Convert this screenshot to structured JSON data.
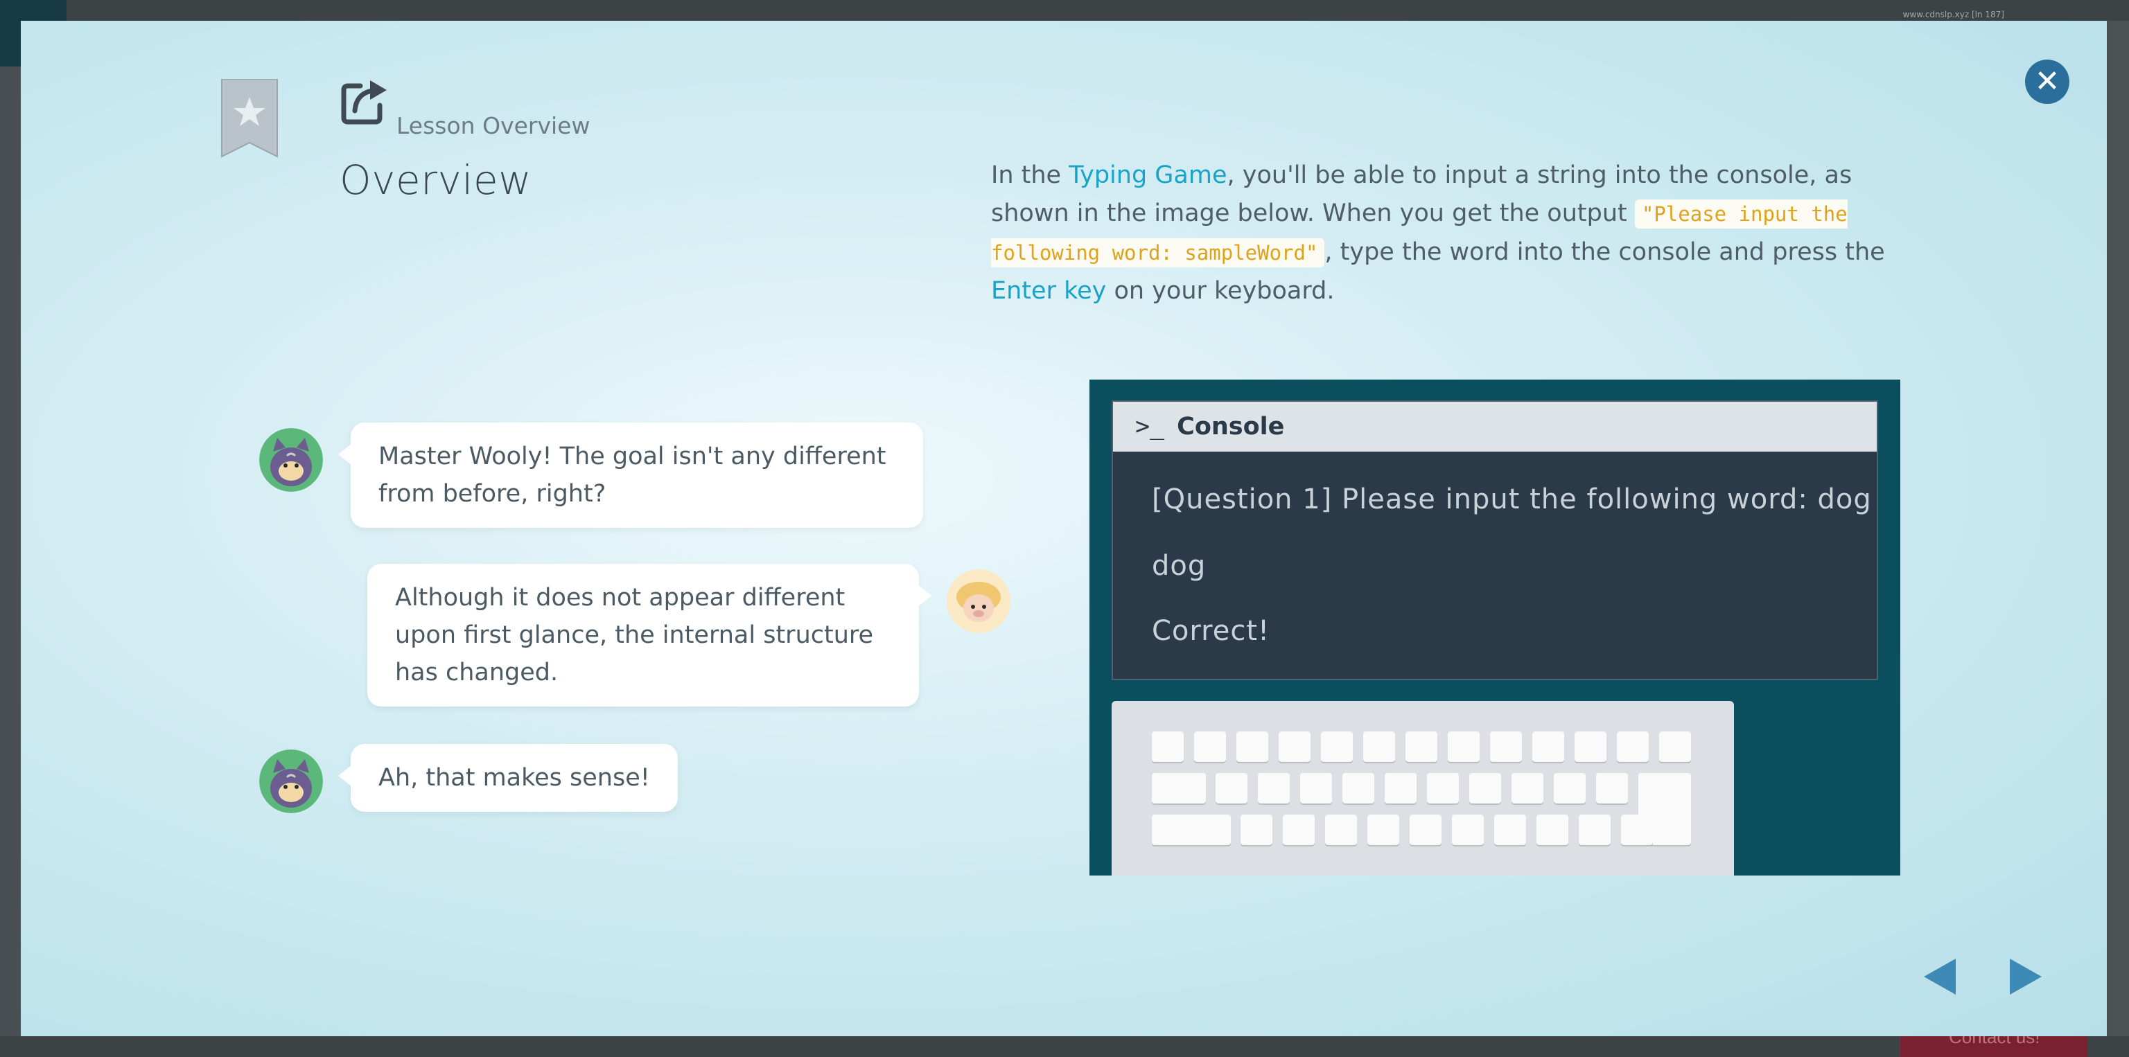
{
  "background": {
    "url_text": "www.cdnslp.xyz [ln 187]",
    "contact_label": "Contact us!"
  },
  "header": {
    "section_label": "Lesson Overview",
    "title": "Overview"
  },
  "description": {
    "part1": "In the ",
    "link1": "Typing Game",
    "part2": ", you'll be able to input a string into the console, as shown in the image below. When you get the output ",
    "code": "\"Please input the following word: sampleWord\"",
    "part3": ", type the word into the console and press the ",
    "link2": "Enter key",
    "part4": " on your keyboard."
  },
  "chat": [
    {
      "speaker": "cat",
      "text": "Master Wooly! The goal isn't any different from before, right?"
    },
    {
      "speaker": "sheep",
      "text": "Although it does not appear different upon first glance, the internal structure has changed."
    },
    {
      "speaker": "cat",
      "text": "Ah, that makes sense!"
    }
  ],
  "console": {
    "title": "Console",
    "prompt_symbol": ">_",
    "lines": [
      "[Question 1] Please input the following word: dog",
      "dog",
      "Correct!"
    ]
  },
  "colors": {
    "accent": "#1aa3c7",
    "code_text": "#dfa21b",
    "close_button": "#2a6f9b",
    "nav_arrows": "#3d8ab6",
    "illustration_bg": "#0b4f5e"
  },
  "icons": {
    "close": "close-icon",
    "bookmark": "bookmark-star-icon",
    "external": "external-link-icon",
    "prev": "arrow-left-icon",
    "next": "arrow-right-icon"
  }
}
